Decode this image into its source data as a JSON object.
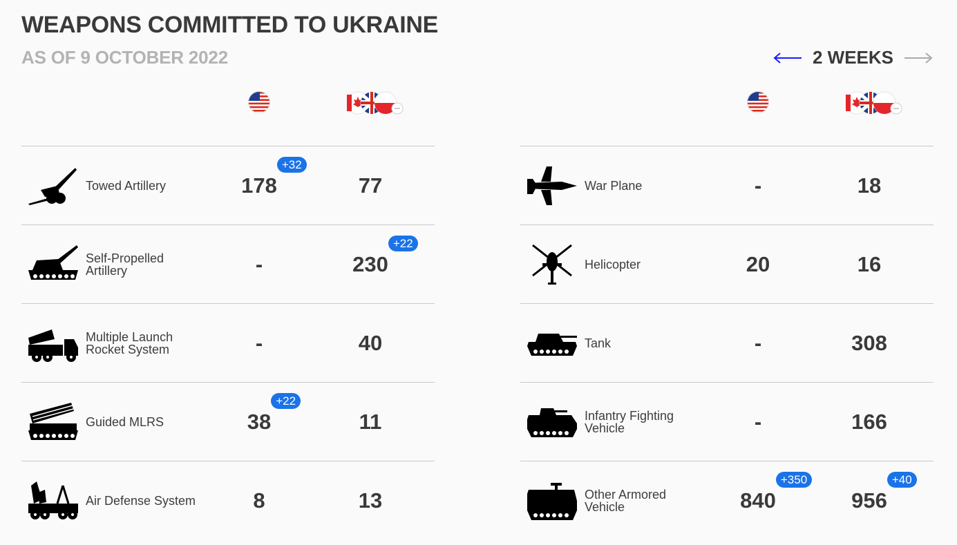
{
  "title": "WEAPONS COMMITTED TO UKRAINE",
  "subtitle": "AS OF 9 OCTOBER 2022",
  "nav": {
    "label": "2 WEEKS",
    "prev_color": "#1a1aff",
    "next_color": "#aaaaaa"
  },
  "colors": {
    "badge": "#1a73e8",
    "divider": "#c9c9c9",
    "text": "#3a3a3a",
    "subtitle": "#b3b3b3"
  },
  "flags": {
    "us": "us-flag-icon",
    "allies": "canada-uk-poland-flags-icon"
  },
  "left": [
    {
      "icon": "towed-artillery-icon",
      "name": "Towed Artillery",
      "us": "178",
      "us_delta": "+32",
      "allies": "77",
      "allies_delta": ""
    },
    {
      "icon": "self-propelled-artillery-icon",
      "name": "Self-Propelled Artillery",
      "us": "-",
      "us_delta": "",
      "allies": "230",
      "allies_delta": "+22"
    },
    {
      "icon": "mlrs-icon",
      "name": "Multiple Launch Rocket System",
      "us": "-",
      "us_delta": "",
      "allies": "40",
      "allies_delta": ""
    },
    {
      "icon": "guided-mlrs-icon",
      "name": "Guided MLRS",
      "us": "38",
      "us_delta": "+22",
      "allies": "11",
      "allies_delta": ""
    },
    {
      "icon": "air-defense-icon",
      "name": "Air Defense System",
      "us": "8",
      "us_delta": "",
      "allies": "13",
      "allies_delta": ""
    }
  ],
  "right": [
    {
      "icon": "war-plane-icon",
      "name": "War Plane",
      "us": "-",
      "us_delta": "",
      "allies": "18",
      "allies_delta": ""
    },
    {
      "icon": "helicopter-icon",
      "name": "Helicopter",
      "us": "20",
      "us_delta": "",
      "allies": "16",
      "allies_delta": ""
    },
    {
      "icon": "tank-icon",
      "name": "Tank",
      "us": "-",
      "us_delta": "",
      "allies": "308",
      "allies_delta": ""
    },
    {
      "icon": "ifv-icon",
      "name": "Infantry Fighting Vehicle",
      "us": "-",
      "us_delta": "",
      "allies": "166",
      "allies_delta": ""
    },
    {
      "icon": "armored-vehicle-icon",
      "name": "Other Armored Vehicle",
      "us": "840",
      "us_delta": "+350",
      "allies": "956",
      "allies_delta": "+40"
    }
  ]
}
